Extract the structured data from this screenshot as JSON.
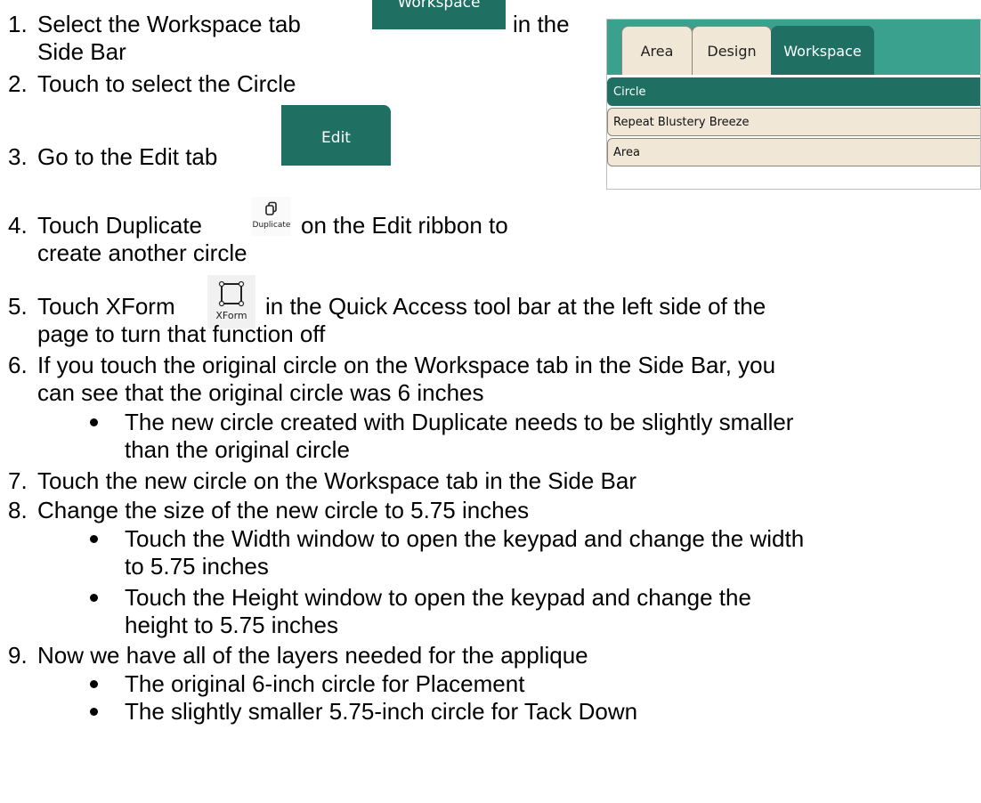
{
  "steps": [
    {
      "num": "1.",
      "before": "Select the Workspace tab",
      "after": "in the",
      "line2": "Side Bar"
    },
    {
      "num": "2.",
      "text": "Touch to select the Circle"
    },
    {
      "num": "3.",
      "text": "Go to the Edit tab"
    },
    {
      "num": "4.",
      "before": "Touch Duplicate",
      "after": "on the Edit ribbon to",
      "line2": "create another circle"
    },
    {
      "num": "5.",
      "before": "Touch XForm",
      "after": "in the Quick Access tool bar at the left side of the",
      "line2": "page to turn that function off"
    },
    {
      "num": "6.",
      "line1": "If you touch the original circle on the Workspace tab in the Side Bar, you",
      "line2": "can see that the original circle was 6 inches",
      "bullets": [
        {
          "l1": "The new circle created with Duplicate needs to be slightly smaller",
          "l2": "than the original circle"
        }
      ]
    },
    {
      "num": "7.",
      "text": "Touch the new circle on the Workspace tab in the Side Bar"
    },
    {
      "num": "8.",
      "text": "Change the size of the new circle to 5.75 inches",
      "bullets": [
        {
          "l1": "Touch the Width window to open the keypad and change the width",
          "l2": "to 5.75 inches"
        },
        {
          "l1": "Touch the Height window to open the keypad and change the",
          "l2": "height to 5.75 inches"
        }
      ]
    },
    {
      "num": "9.",
      "text": "Now we have all of the layers needed for the applique",
      "bullets": [
        {
          "l1": "The original 6-inch circle for Placement"
        },
        {
          "l1": "The slightly smaller 5.75-inch circle for Tack Down"
        }
      ]
    }
  ],
  "icons": {
    "workspace_tab_label": "Workspace",
    "edit_tab_label": "Edit",
    "duplicate_label": "Duplicate",
    "xform_label": "XForm"
  },
  "sidebar": {
    "tabs": [
      "Area",
      "Design",
      "Workspace"
    ],
    "active_tab": "Workspace",
    "items": [
      "Circle",
      "Repeat Blustery Breeze",
      "Area"
    ],
    "selected_item": "Circle",
    "colors": {
      "active": "#1f6f63",
      "tabbar": "#3aa18f",
      "inactive": "#f1e7d6"
    }
  }
}
